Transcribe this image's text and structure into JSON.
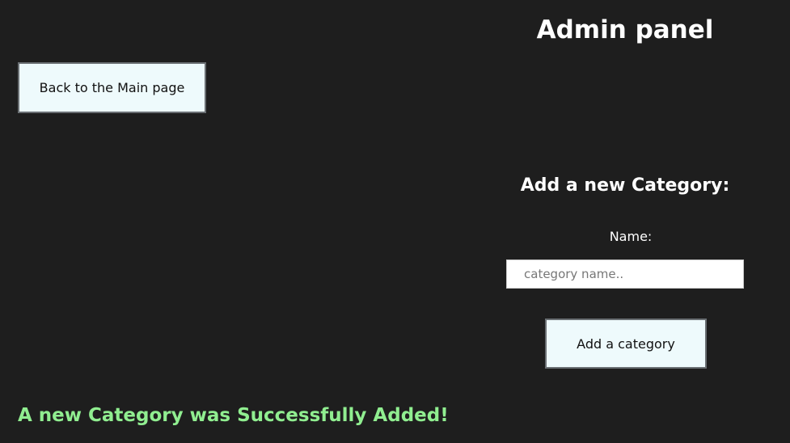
{
  "page": {
    "title": "Admin panel"
  },
  "nav": {
    "back_label": "Back to the Main page"
  },
  "form": {
    "heading": "Add a new Category:",
    "name_label": "Name:",
    "name_placeholder": "category name..",
    "name_value": "",
    "submit_label": "Add a category"
  },
  "status": {
    "message": "A new Category was Successfully Added!",
    "color": "#90ee90"
  },
  "theme": {
    "background": "#1e1e1e",
    "button_bg": "#eefafc"
  }
}
